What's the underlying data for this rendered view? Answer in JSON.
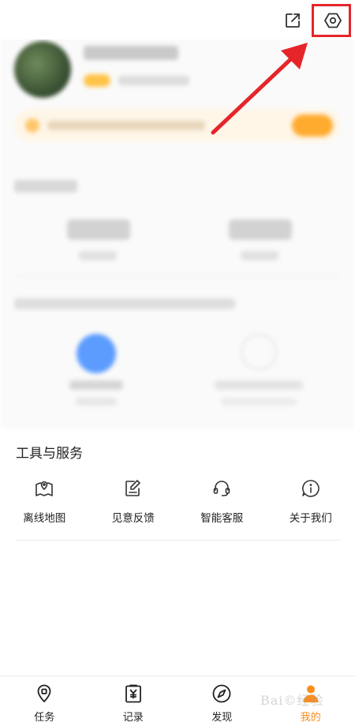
{
  "top_bar": {
    "share_icon": "share-icon",
    "settings_icon": "settings-hexagon-icon"
  },
  "annotation": {
    "color": "#e5252a"
  },
  "tools": {
    "title": "工具与服务",
    "items": [
      {
        "label": "离线地图",
        "icon": "offline-map-icon"
      },
      {
        "label": "见意反馈",
        "icon": "feedback-icon"
      },
      {
        "label": "智能客服",
        "icon": "headset-icon"
      },
      {
        "label": "关于我们",
        "icon": "info-icon"
      }
    ]
  },
  "tabbar": {
    "items": [
      {
        "label": "任务",
        "icon": "location-pin-icon"
      },
      {
        "label": "记录",
        "icon": "receipt-yen-icon"
      },
      {
        "label": "发现",
        "icon": "compass-icon"
      },
      {
        "label": "我的",
        "icon": "user-icon",
        "active": true
      }
    ],
    "active_color": "#ff8c1a"
  },
  "watermark": {
    "text": "Bai©经验"
  }
}
